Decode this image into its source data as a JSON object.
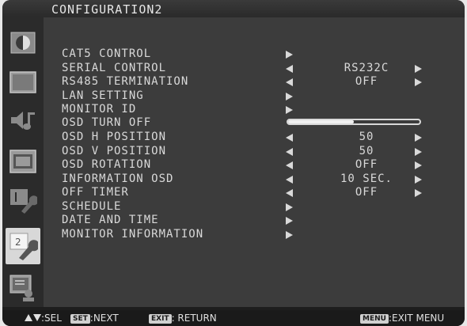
{
  "title": "CONFIGURATION2",
  "sidebar": {
    "icons": [
      {
        "name": "picture-icon"
      },
      {
        "name": "screen-icon"
      },
      {
        "name": "audio-icon"
      },
      {
        "name": "schedule-icon"
      },
      {
        "name": "configuration1-icon"
      },
      {
        "name": "configuration2-icon",
        "active": true,
        "number": "2"
      },
      {
        "name": "advanced-option-icon"
      }
    ]
  },
  "menu": {
    "items": [
      {
        "label": "CAT5 CONTROL"
      },
      {
        "label": "SERIAL CONTROL",
        "value": "RS232C"
      },
      {
        "label": "RS485 TERMINATION",
        "value": "OFF"
      },
      {
        "label": "LAN SETTING"
      },
      {
        "label": "MONITOR ID"
      },
      {
        "label": "OSD TURN OFF",
        "slider_level": 0.5
      },
      {
        "label": "OSD H POSITION",
        "value": "50"
      },
      {
        "label": "OSD V POSITION",
        "value": "50"
      },
      {
        "label": "OSD ROTATION",
        "value": "OFF"
      },
      {
        "label": "INFORMATION OSD",
        "value": "10 SEC."
      },
      {
        "label": "OFF TIMER",
        "value": "OFF"
      },
      {
        "label": "SCHEDULE"
      },
      {
        "label": "DATE AND TIME"
      },
      {
        "label": "MONITOR INFORMATION"
      }
    ]
  },
  "footer": {
    "sel": ":SEL",
    "set_key": "SET",
    "next": ":NEXT",
    "exit_key": "EXIT",
    "return": ": RETURN",
    "menu_key": "MENU",
    "exit_menu": ":EXIT MENU"
  }
}
